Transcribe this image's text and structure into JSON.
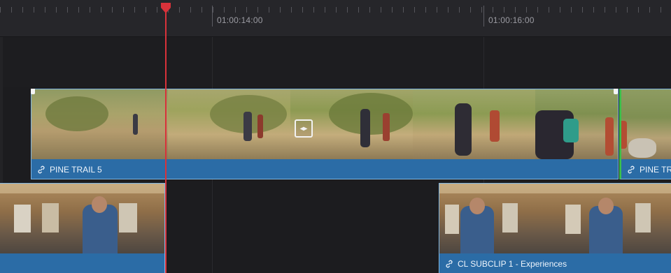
{
  "ruler": {
    "timecodes": [
      "01:00:14:00",
      "01:00:16:00"
    ]
  },
  "clips": {
    "pine_trail_5": {
      "name": "PINE TRAIL 5"
    },
    "pine_trail_next": {
      "name": "PINE TR"
    },
    "cl_subclip_a": {
      "name": ""
    },
    "cl_subclip_b": {
      "name": "CL SUBCLIP 1 - Experiences"
    }
  },
  "colors": {
    "clip_fill": "#2b6ca6",
    "clip_border": "#7fb6e2",
    "playhead": "#d8323a",
    "selected_edge": "#3bbf4a",
    "background": "#1c1c1f"
  },
  "icons": {
    "link": "link-icon",
    "trim": "trim-icon",
    "playhead": "playhead-icon"
  }
}
